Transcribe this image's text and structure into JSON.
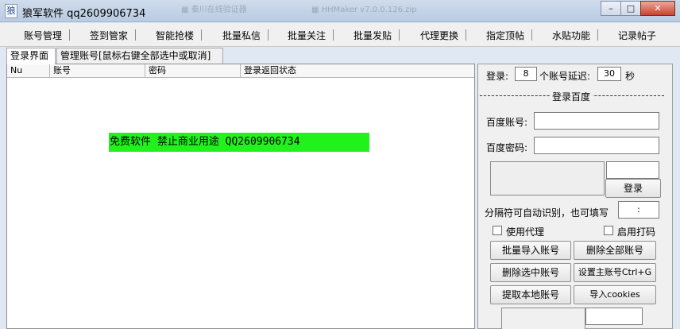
{
  "window": {
    "title": "狼军软件 qq2609906734",
    "app_icon_glyph": "狼",
    "background_tabs": [
      "▦  秦川在线验证器",
      "▦  HHMaker v7.0.0.126.zip"
    ],
    "controls": {
      "minimize": "–",
      "maximize": "□",
      "close": "✕"
    }
  },
  "menu": {
    "items": [
      "账号管理",
      "签到管家",
      "智能抢楼",
      "批量私信",
      "批量关注",
      "批量发贴",
      "代理更换",
      "指定顶帖",
      "水贴功能",
      "记录帖子"
    ]
  },
  "tabs": [
    {
      "label": "登录界面",
      "active": true
    },
    {
      "label": "管理账号[鼠标右键全部选中或取消]",
      "active": false
    }
  ],
  "list": {
    "columns": [
      "Nu",
      "账号",
      "密码",
      "登录返回状态"
    ],
    "rows": []
  },
  "banner": {
    "text": "免费软件  禁止商业用途 QQ2609906734",
    "color": "#21f21b"
  },
  "panel": {
    "login_label": "登录:",
    "batch_count": "8",
    "delay_label": "个账号延迟:",
    "delay_value": "30",
    "delay_unit": "秒",
    "section_title": "登录百度",
    "baidu_account_label": "百度账号:",
    "baidu_account_value": "",
    "baidu_password_label": "百度密码:",
    "baidu_password_value": "",
    "login_button": "登录",
    "separator_label": "分隔符可自动识别，也可填写",
    "separator_value": ":",
    "use_proxy_label": "使用代理",
    "use_proxy_checked": false,
    "enable_captcha_label": "启用打码",
    "enable_captcha_checked": false,
    "buttons": {
      "import_accounts": "批量导入账号",
      "delete_all": "删除全部账号",
      "delete_selected": "删除选中账号",
      "set_main": "设置主账号Ctrl+G",
      "extract_local": "提取本地账号",
      "import_cookies": "导入cookies"
    }
  }
}
